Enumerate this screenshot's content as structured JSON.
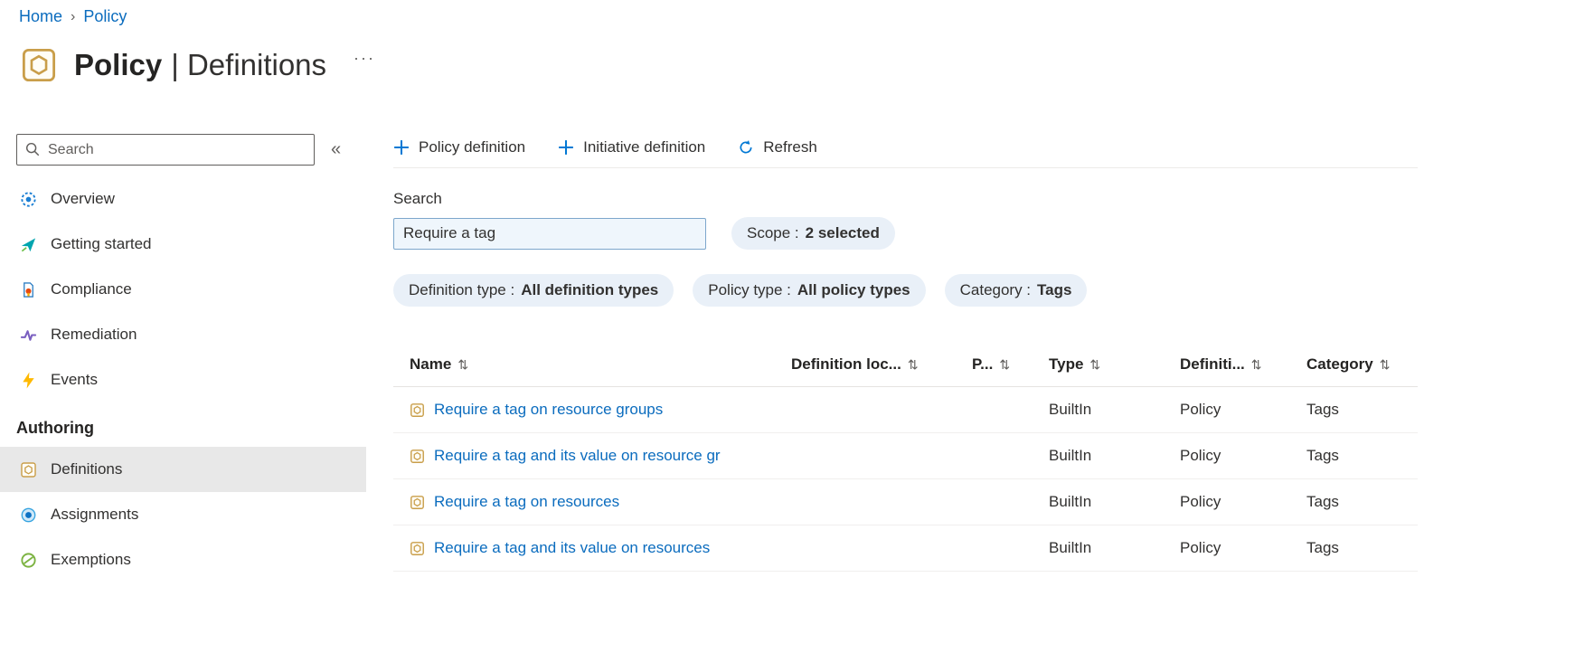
{
  "breadcrumb": {
    "home": "Home",
    "separator": "›",
    "current": "Policy"
  },
  "header": {
    "title_primary": "Policy",
    "title_secondary": "| Definitions",
    "more": "···"
  },
  "sidebar": {
    "search_placeholder": "Search",
    "collapse": "«",
    "items": [
      {
        "label": "Overview",
        "icon": "overview-icon"
      },
      {
        "label": "Getting started",
        "icon": "getting-started-icon"
      },
      {
        "label": "Compliance",
        "icon": "compliance-icon"
      },
      {
        "label": "Remediation",
        "icon": "remediation-icon"
      },
      {
        "label": "Events",
        "icon": "events-icon"
      }
    ],
    "section": "Authoring",
    "authoring": [
      {
        "label": "Definitions",
        "icon": "definitions-icon",
        "selected": true
      },
      {
        "label": "Assignments",
        "icon": "assignments-icon",
        "selected": false
      },
      {
        "label": "Exemptions",
        "icon": "exemptions-icon",
        "selected": false
      }
    ]
  },
  "toolbar": {
    "items": [
      {
        "label": "Policy definition",
        "icon": "plus-icon"
      },
      {
        "label": "Initiative definition",
        "icon": "plus-icon"
      },
      {
        "label": "Refresh",
        "icon": "refresh-icon"
      }
    ]
  },
  "filters": {
    "search_label": "Search",
    "search_value": "Require a tag",
    "pills": [
      {
        "label": "Scope :",
        "value": "2 selected"
      },
      {
        "label": "Definition type :",
        "value": "All definition types"
      },
      {
        "label": "Policy type :",
        "value": "All policy types"
      },
      {
        "label": "Category :",
        "value": "Tags"
      }
    ]
  },
  "table": {
    "sort_icon": "⇅",
    "columns": [
      {
        "label": "Name"
      },
      {
        "label": "Definition loc..."
      },
      {
        "label": "P..."
      },
      {
        "label": "Type"
      },
      {
        "label": "Definiti..."
      },
      {
        "label": "Category"
      }
    ],
    "rows": [
      {
        "name": "Require a tag on resource groups",
        "definition_location": "",
        "policy": "",
        "type": "BuiltIn",
        "definition_type": "Policy",
        "category": "Tags"
      },
      {
        "name": "Require a tag and its value on resource gr",
        "definition_location": "",
        "policy": "",
        "type": "BuiltIn",
        "definition_type": "Policy",
        "category": "Tags"
      },
      {
        "name": "Require a tag on resources",
        "definition_location": "",
        "policy": "",
        "type": "BuiltIn",
        "definition_type": "Policy",
        "category": "Tags"
      },
      {
        "name": "Require a tag and its value on resources",
        "definition_location": "",
        "policy": "",
        "type": "BuiltIn",
        "definition_type": "Policy",
        "category": "Tags"
      }
    ]
  },
  "colors": {
    "accent": "#0078d4",
    "link": "#0b6cbe",
    "pill_background": "#e9f0f8",
    "search_background": "#eff6fc",
    "selected_item_background": "#e8e8e8",
    "policy_icon": "#c99e4a"
  }
}
